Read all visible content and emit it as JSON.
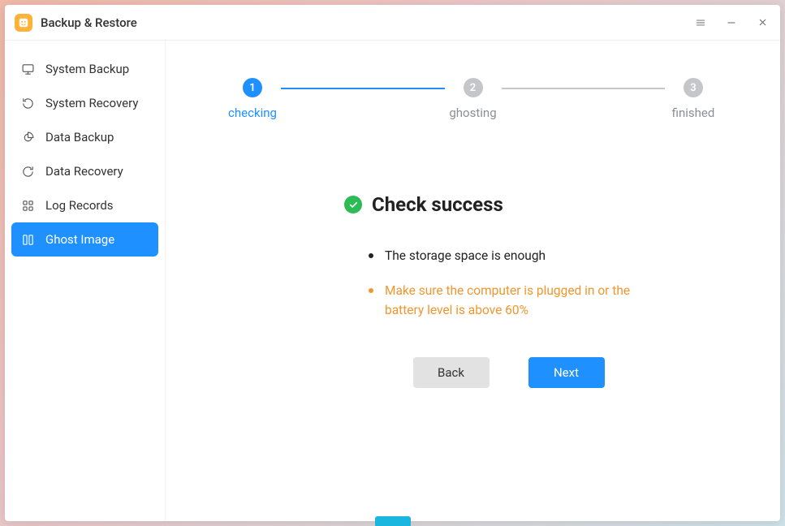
{
  "app": {
    "title": "Backup & Restore"
  },
  "sidebar": {
    "items": [
      {
        "label": "System Backup"
      },
      {
        "label": "System Recovery"
      },
      {
        "label": "Data Backup"
      },
      {
        "label": "Data Recovery"
      },
      {
        "label": "Log Records"
      },
      {
        "label": "Ghost Image"
      }
    ]
  },
  "stepper": {
    "steps": [
      {
        "num": "1",
        "label": "checking"
      },
      {
        "num": "2",
        "label": "ghosting"
      },
      {
        "num": "3",
        "label": "finished"
      }
    ]
  },
  "status": {
    "title": "Check success",
    "bullets": [
      {
        "text": "The storage space is enough",
        "tone": "black"
      },
      {
        "text": "Make sure the computer is plugged in or the battery level is above 60%",
        "tone": "orange"
      }
    ]
  },
  "buttons": {
    "back": "Back",
    "next": "Next"
  }
}
